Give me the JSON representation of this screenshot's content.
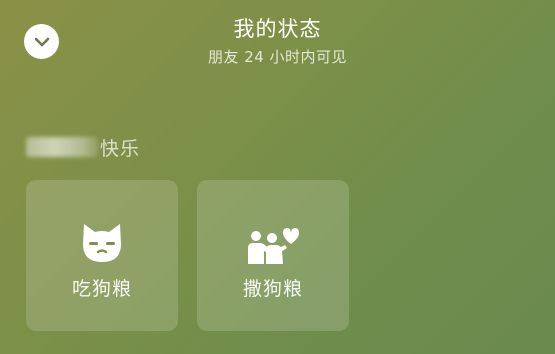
{
  "header": {
    "title": "我的状态",
    "subtitle": "朋友 24 小时内可见"
  },
  "friend": {
    "status_text": "快乐"
  },
  "cards": [
    {
      "label": "吃狗粮",
      "icon": "cat-face-icon"
    },
    {
      "label": "撒狗粮",
      "icon": "hug-heart-icon"
    }
  ],
  "colors": {
    "background_top": "#8a9147",
    "background_bottom": "#6a8a4e",
    "text": "#ffffff"
  }
}
